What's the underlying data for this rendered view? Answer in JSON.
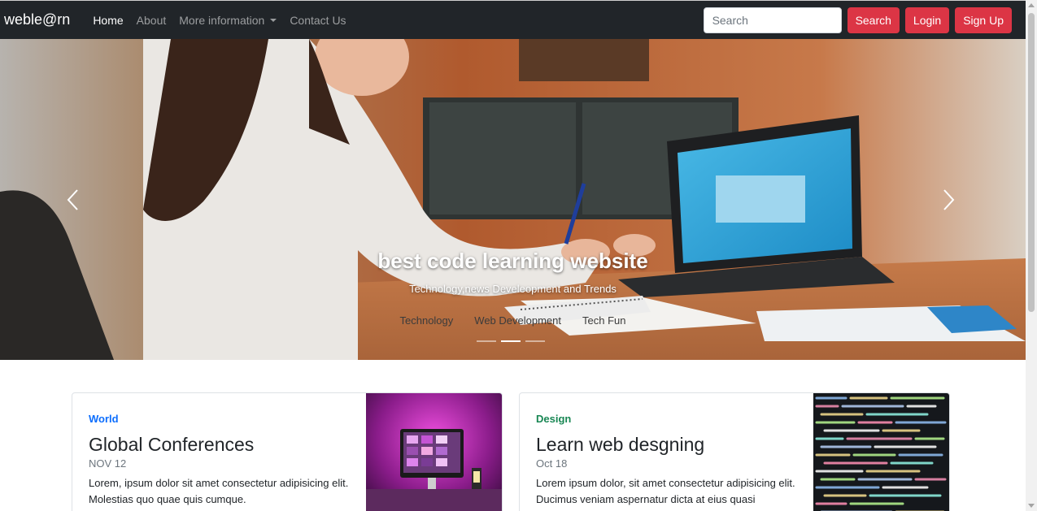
{
  "navbar": {
    "brand": "weble@rn",
    "links": [
      {
        "label": "Home",
        "active": true
      },
      {
        "label": "About",
        "active": false
      },
      {
        "label": "More information",
        "dropdown": true
      },
      {
        "label": "Contact Us"
      }
    ],
    "search": {
      "placeholder": "Search"
    },
    "buttons": {
      "search": "Search",
      "login": "Login",
      "signup": "Sign Up"
    }
  },
  "hero": {
    "title": "best code learning website",
    "subtitle": "Technology,news Develeopment and Trends",
    "links": [
      "Technology",
      "Web Development",
      "Tech Fun"
    ],
    "slide_count": 3,
    "active_slide": 2,
    "prev_icon": "chevron-left-icon",
    "next_icon": "chevron-right-icon"
  },
  "cards": [
    {
      "category": "World",
      "category_color": "#0d6efd",
      "title": "Global Conferences",
      "date": "NOV 12",
      "text": "Lorem, ipsum dolor sit amet consectetur adipisicing elit. Molestias quo quae quis cumque."
    },
    {
      "category": "Design",
      "category_color": "#198754",
      "title": "Learn web desgning",
      "date": "Oct 18",
      "text": "Lorem ipsum dolor, sit amet consectetur adipisicing elit. Ducimus veniam aspernatur dicta at eius quasi"
    }
  ],
  "colors": {
    "navbar_bg": "#212529",
    "accent_red": "#dc3545"
  }
}
